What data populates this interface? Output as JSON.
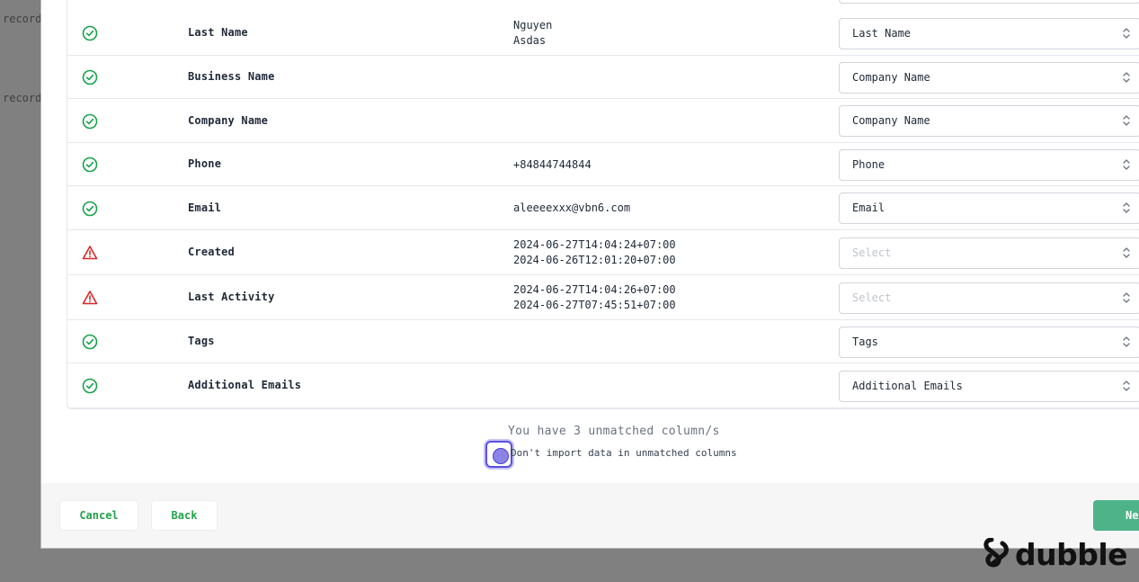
{
  "background": {
    "labels": [
      "record",
      "record"
    ]
  },
  "rows": [
    {
      "field": "Last Name",
      "samples": [
        "Nguyen",
        "Asdas"
      ],
      "status": "ok",
      "mapping": "Last Name"
    },
    {
      "field": "Business Name",
      "samples": [],
      "status": "ok",
      "mapping": "Company Name"
    },
    {
      "field": "Company Name",
      "samples": [],
      "status": "ok",
      "mapping": "Company Name"
    },
    {
      "field": "Phone",
      "samples": [
        "+84844744844"
      ],
      "status": "ok",
      "mapping": "Phone"
    },
    {
      "field": "Email",
      "samples": [
        "aleeeexxx@vbn6.com"
      ],
      "status": "ok",
      "mapping": "Email"
    },
    {
      "field": "Created",
      "samples": [
        "2024-06-27T14:04:24+07:00",
        "2024-06-26T12:01:20+07:00"
      ],
      "status": "warning",
      "mapping": "Select"
    },
    {
      "field": "Last Activity",
      "samples": [
        "2024-06-27T14:04:26+07:00",
        "2024-06-27T07:45:51+07:00"
      ],
      "status": "warning",
      "mapping": "Select"
    },
    {
      "field": "Tags",
      "samples": [],
      "status": "ok",
      "mapping": "Tags"
    },
    {
      "field": "Additional Emails",
      "samples": [],
      "status": "ok",
      "mapping": "Additional Emails"
    }
  ],
  "summary": {
    "unmatched_text": "You have 3 unmatched column/s",
    "checkbox_label": "Don't import data in unmatched columns"
  },
  "footer": {
    "cancel_label": "Cancel",
    "back_label": "Back",
    "next_label": "Next"
  },
  "watermark": {
    "text": "dubble"
  },
  "colors": {
    "ok": "#16a34a",
    "warning": "#dc2626",
    "accent": "#5b4fe0",
    "next_button": "#4fb38a"
  },
  "icons": {
    "ok": "check-circle-icon",
    "warning": "warning-triangle-icon",
    "select": "chevron-up-down-icon"
  }
}
